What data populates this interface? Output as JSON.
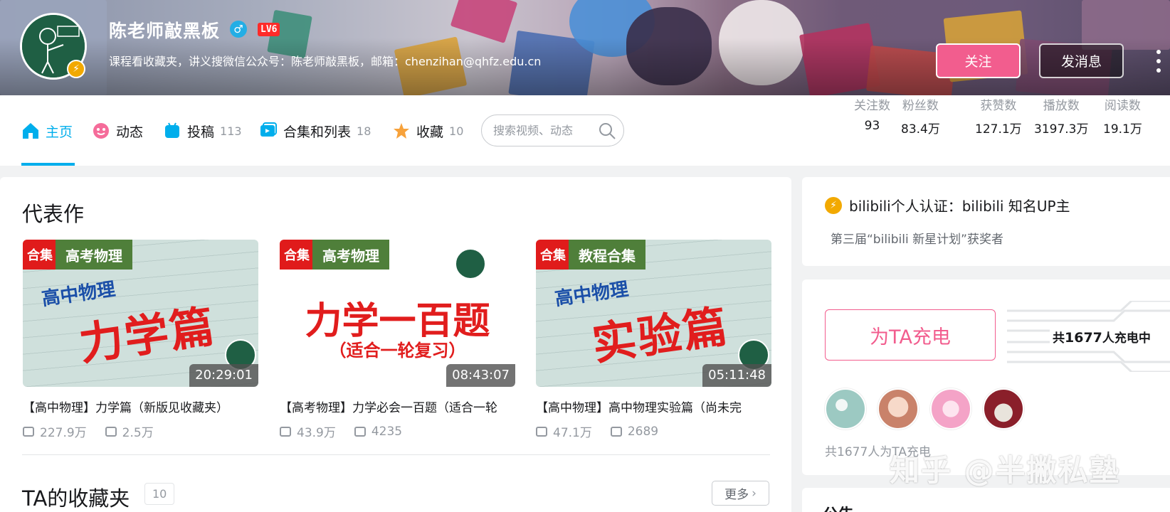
{
  "profile": {
    "name": "陈老师敲黑板",
    "level": "LV6",
    "sign": "课程看收藏夹，讲义搜微信公众号：陈老师敲黑板，邮箱：chenzihan@qhfz.edu.cn",
    "follow_label": "关注",
    "message_label": "发消息"
  },
  "nav": {
    "items": [
      {
        "label": "主页",
        "count": "",
        "icon": "home-icon"
      },
      {
        "label": "动态",
        "count": "",
        "icon": "dynamic-icon"
      },
      {
        "label": "投稿",
        "count": "113",
        "icon": "upload-icon"
      },
      {
        "label": "合集和列表",
        "count": "18",
        "icon": "collection-icon"
      },
      {
        "label": "收藏",
        "count": "10",
        "icon": "star-icon"
      }
    ],
    "search_placeholder": "搜索视频、动态",
    "stats": [
      {
        "label": "关注数",
        "value": "93"
      },
      {
        "label": "粉丝数",
        "value": "83.4万"
      },
      {
        "label": "获赞数",
        "value": "127.1万"
      },
      {
        "label": "播放数",
        "value": "3197.3万"
      },
      {
        "label": "阅读数",
        "value": "19.1万"
      }
    ]
  },
  "masterpieces": {
    "title": "代表作",
    "videos": [
      {
        "tag1": "合集",
        "tag2": "高考物理",
        "cover_line1": "高中物理",
        "cover_line2": "力学篇",
        "duration": "20:29:01",
        "title": "【高中物理】力学篇（新版见收藏夹）",
        "plays": "227.9万",
        "danmaku": "2.5万"
      },
      {
        "tag1": "合集",
        "tag2": "高考物理",
        "cover_line1": "力学一百题",
        "cover_line2": "（适合一轮复习）",
        "duration": "08:43:07",
        "title": "【高考物理】力学必会一百题（适合一轮",
        "plays": "43.9万",
        "danmaku": "4235"
      },
      {
        "tag1": "合集",
        "tag2": "教程合集",
        "cover_line1": "高中物理",
        "cover_line2": "实验篇",
        "duration": "05:11:48",
        "title": "【高中物理】高中物理实验篇（尚未完",
        "plays": "47.1万",
        "danmaku": "2689"
      }
    ]
  },
  "favorites": {
    "title": "TA的收藏夹",
    "count": "10",
    "more_label": "更多"
  },
  "auth": {
    "line1": "bilibili个人认证：bilibili 知名UP主",
    "line2": "第三届“bilibili 新星计划”获奖者"
  },
  "charge": {
    "button_label": "为TA充电",
    "total_prefix": "共",
    "total_count": "1677",
    "total_suffix": "人充电中",
    "note": "共1677人为TA充电"
  },
  "notice": {
    "title": "公告"
  },
  "watermark": "知乎 @半撇私塾",
  "colors": {
    "accent": "#00aeec",
    "pink": "#f25d8e",
    "tag_red": "#e01b1b",
    "tag_green": "#4f7f3a"
  }
}
